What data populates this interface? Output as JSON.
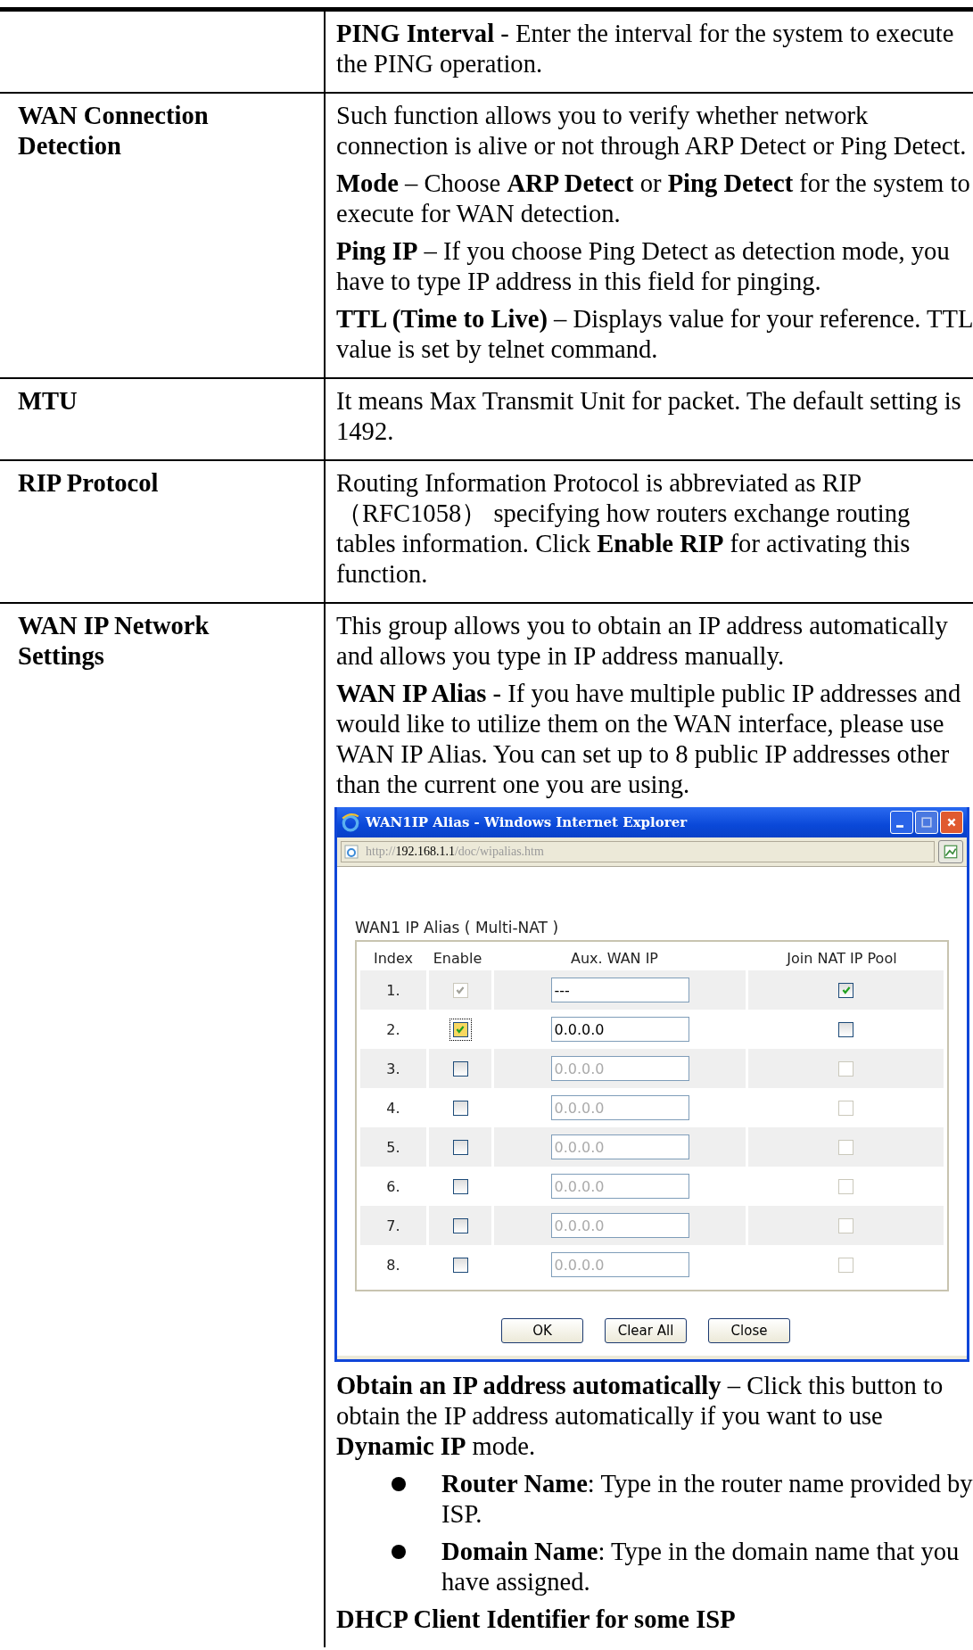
{
  "rows": [
    {
      "label": "",
      "items": [
        {
          "kind": "text",
          "text": "**PING Interval** - Enter the interval for the system to execute the PING operation."
        }
      ]
    },
    {
      "label": "WAN Connection Detection",
      "items": [
        {
          "kind": "text",
          "text": "Such function allows you to verify whether network connection is alive or not through ARP Detect or Ping Detect."
        },
        {
          "kind": "text",
          "text": "**Mode** – Choose **ARP Detect** or **Ping Detect** for the system to execute for WAN detection."
        },
        {
          "kind": "text",
          "text": "**Ping IP** – If you choose Ping Detect as detection mode, you have to type IP address in this field for pinging."
        },
        {
          "kind": "text",
          "text": "**TTL (Time to Live)** – Displays value for your reference. TTL value is set by telnet command."
        }
      ]
    },
    {
      "label": "MTU",
      "items": [
        {
          "kind": "text",
          "text": "It means Max Transmit Unit for packet. The default setting is 1492."
        }
      ]
    },
    {
      "label": "RIP Protocol",
      "items": [
        {
          "kind": "text",
          "text": "Routing Information Protocol is abbreviated as RIP （RFC1058） specifying how routers exchange routing tables information. Click **Enable RIP** for activating this function."
        }
      ]
    },
    {
      "label": "WAN IP Network Settings",
      "items": [
        {
          "kind": "text",
          "text": "This group allows you to obtain an IP address automatically and allows you type in IP address manually."
        },
        {
          "kind": "text",
          "text": "**WAN IP Alias** - If you have multiple public IP addresses and would like to utilize them on the WAN interface, please use WAN IP Alias. You can set up to 8 public IP addresses other than the current one you are using."
        },
        {
          "kind": "dialog"
        },
        {
          "kind": "text",
          "text": "**Obtain an IP address automatically** – Click this button to obtain the IP address automatically if you want to use **Dynamic IP** mode."
        },
        {
          "kind": "bullet",
          "text": "**Router Name**: Type in the router name provided by ISP."
        },
        {
          "kind": "bullet",
          "text": "**Domain Name**: Type in the domain name that you have assigned."
        },
        {
          "kind": "text",
          "text": "**DHCP Client Identifier for some ISP**"
        }
      ]
    }
  ],
  "dialog": {
    "title": "WAN1IP Alias - Windows Internet Explorer",
    "url_scheme": "http://",
    "url_host": "192.168.1.1",
    "url_path": "/doc/wipalias.htm",
    "heading": "WAN1 IP Alias ( Multi-NAT )",
    "columns": [
      "Index",
      "Enable",
      "Aux. WAN IP",
      "Join NAT IP Pool"
    ],
    "rows": [
      {
        "index": "1.",
        "enable_checked": true,
        "enable_disabled": true,
        "ip": "---",
        "ip_disabled": false,
        "join_checked": true,
        "join_disabled": false
      },
      {
        "index": "2.",
        "enable_checked": true,
        "enable_disabled": false,
        "ip": "0.0.0.0",
        "ip_disabled": false,
        "join_checked": false,
        "join_disabled": false
      },
      {
        "index": "3.",
        "enable_checked": false,
        "enable_disabled": false,
        "ip": "0.0.0.0",
        "ip_disabled": true,
        "join_checked": false,
        "join_disabled": true
      },
      {
        "index": "4.",
        "enable_checked": false,
        "enable_disabled": false,
        "ip": "0.0.0.0",
        "ip_disabled": true,
        "join_checked": false,
        "join_disabled": true
      },
      {
        "index": "5.",
        "enable_checked": false,
        "enable_disabled": false,
        "ip": "0.0.0.0",
        "ip_disabled": true,
        "join_checked": false,
        "join_disabled": true
      },
      {
        "index": "6.",
        "enable_checked": false,
        "enable_disabled": false,
        "ip": "0.0.0.0",
        "ip_disabled": true,
        "join_checked": false,
        "join_disabled": true
      },
      {
        "index": "7.",
        "enable_checked": false,
        "enable_disabled": false,
        "ip": "0.0.0.0",
        "ip_disabled": true,
        "join_checked": false,
        "join_disabled": true
      },
      {
        "index": "8.",
        "enable_checked": false,
        "enable_disabled": false,
        "ip": "0.0.0.0",
        "ip_disabled": true,
        "join_checked": false,
        "join_disabled": true
      }
    ],
    "buttons": [
      "OK",
      "Clear All",
      "Close"
    ]
  }
}
